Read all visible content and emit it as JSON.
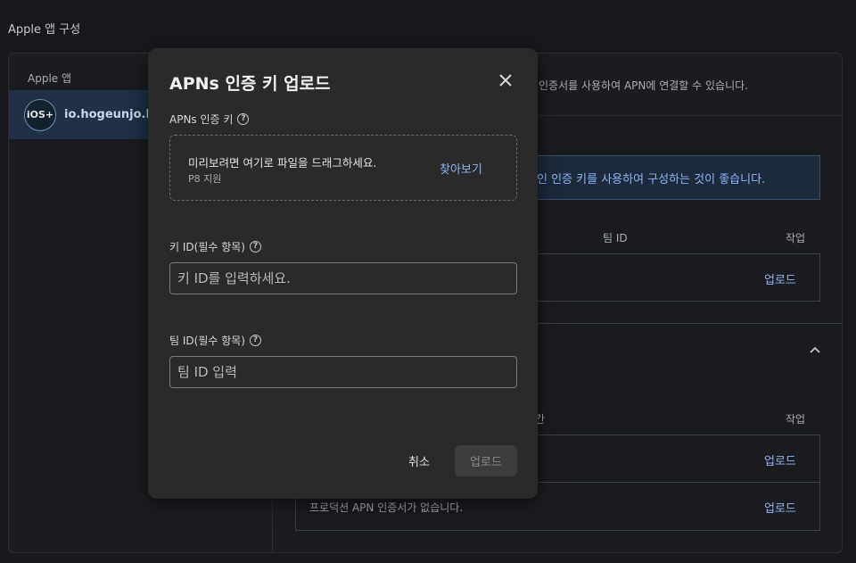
{
  "page": {
    "heading": "Apple 앱 구성"
  },
  "sidebar": {
    "title": "Apple 앱",
    "items": [
      {
        "badge": "iOS+",
        "label": "io.hogeunjo.Fir"
      }
    ]
  },
  "background": {
    "description": "인증서를 사용하여 APN에 연결할 수 있습니다.",
    "banner": "인 인증 키를 사용하여 구성하는 것이 좋습니다.",
    "section_a": {
      "col_team_id": "팀 ID",
      "col_action": "작업",
      "upload_label": "업로드"
    },
    "section_b": {
      "col_partial": "간",
      "col_action": "작업",
      "row1_upload": "업로드",
      "row2_text": "프로덕션 APN 인증서가 없습니다.",
      "row2_upload": "업로드"
    }
  },
  "dialog": {
    "title": "APNs 인증 키 업로드",
    "key_label": "APNs 인증 키",
    "drop_text": "미리보려면 여기로 파일을 드래그하세요.",
    "drop_sub": "P8 지원",
    "browse_label": "찾아보기",
    "key_id_label": "키 ID(필수 항목)",
    "key_id_placeholder": "키 ID를 입력하세요.",
    "team_id_label": "팀 ID(필수 항목)",
    "team_id_placeholder": "팀 ID 입력",
    "cancel_label": "취소",
    "submit_label": "업로드"
  },
  "colors": {
    "accent": "#8ab4f8",
    "dialog_bg": "#2a2a2a",
    "page_bg": "#17181c"
  },
  "icons": {
    "close": "close-icon",
    "help": "help-icon",
    "chevron": "chevron-up-icon"
  }
}
